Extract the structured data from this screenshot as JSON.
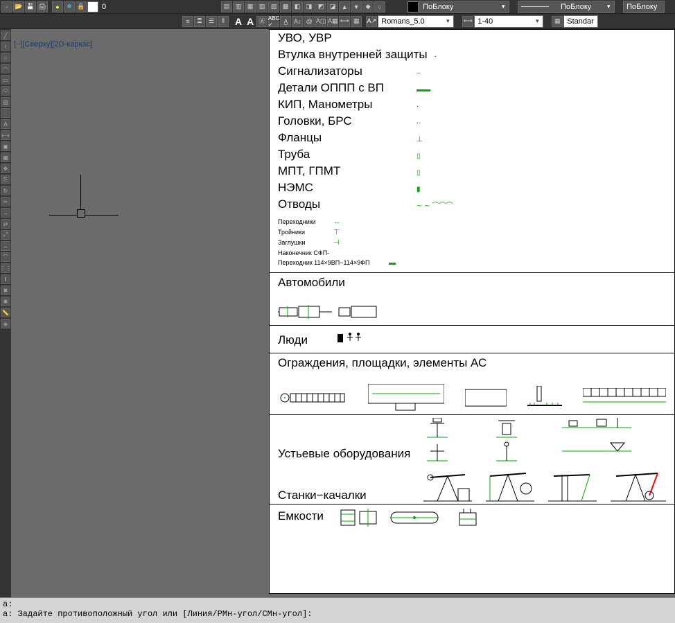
{
  "toolbar": {
    "row1_layer_value": "0",
    "row1_dropdowns": {
      "byblock1": "ПоБлоку",
      "byblock2": "ПоБлоку",
      "byblock3": "ПоБлоку"
    },
    "icons_row1": [
      "new",
      "open",
      "save",
      "saveas",
      "plot",
      "publish",
      "cut",
      "copy",
      "paste",
      "match",
      "undo",
      "redo",
      "pan",
      "zoom",
      "zoomwin",
      "zoomall",
      "props",
      "dist",
      "area",
      "help",
      "sheet",
      "layout",
      "layer",
      "layeriso",
      "layeroff",
      "freeze",
      "lock"
    ],
    "row2_font": "Romans_5.0",
    "row2_scale": "1-40",
    "row2_style": "Standar",
    "row2_icons": [
      "list1",
      "list2",
      "list3",
      "list4",
      "mtext",
      "A",
      "AA",
      "dim",
      "spell",
      "check",
      "table",
      "field",
      "find",
      "txtstyle",
      "dimstyle"
    ]
  },
  "viewport": {
    "label_left": "[−][Сверху][2D-каркас]"
  },
  "categories_top": [
    {
      "label": "УВО, УВР"
    },
    {
      "label": "Втулка внутренней защиты",
      "mark": "·"
    },
    {
      "label": "Сигнализаторы",
      "mark": "–"
    },
    {
      "label": "Детали ОППП с ВП",
      "mark": "▬▬"
    },
    {
      "label": "КИП, Манометры",
      "mark": "·"
    },
    {
      "label": "Головки, БРС",
      "mark": "··"
    },
    {
      "label": "Фланцы",
      "mark": "⊥"
    },
    {
      "label": "Труба",
      "mark": "▯"
    },
    {
      "label": "МПТ, ГПМТ",
      "mark": "▯"
    },
    {
      "label": "НЭМС",
      "mark": "▮"
    },
    {
      "label": "Отводы",
      "mark": "∼ ∼ ⌒⌒⌒"
    }
  ],
  "sublist": [
    {
      "label": "Переходники",
      "mark": "↔"
    },
    {
      "label": "Тройники",
      "mark": "⊤"
    },
    {
      "label": "Заглушки",
      "mark": "⊣"
    },
    {
      "label": "Наконечник СФП-",
      "mark": ""
    },
    {
      "label": "Переходник 114×9ВП−114×9ФП",
      "mark": "▬"
    }
  ],
  "sections": {
    "auto": "Автомобили",
    "people": "Люди",
    "fence": "Ограждения, площадки, элементы АС",
    "wellhead": "Устьевые оборудования",
    "pumpjack": "Станки−качалки",
    "tanks": "Емкости"
  },
  "cmdline": {
    "line1": "а:",
    "line2": "а: Задайте противоположный угол или [Линия/РМн-угол/СМн-угол]:"
  }
}
